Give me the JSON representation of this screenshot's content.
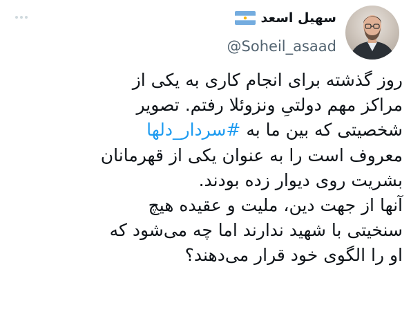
{
  "tweet": {
    "author": {
      "name": "سهیل اسعد",
      "handle": "@Soheil_asaad",
      "flag": "argentina-flag-icon"
    },
    "text_lines": [
      "روز گذشته برای انجام کاری به یکی از",
      "مراکز مهم دولتیِ ونزوئلا رفتم. تصویر",
      "شخصیتی که بین ما به",
      "معروف است را به عنوان یکی از قهرمانان",
      "بشریت روی دیوار زده بودند.",
      "آنها از جهت دین، ملیت و عقیده هیچ",
      "سنخیتی با شهید ندارند اما چه می‌شود که",
      "او را الگوی خود قرار می‌دهند؟"
    ],
    "hashtag": "#سردار_دلها"
  },
  "colors": {
    "text": "#0f1419",
    "secondary": "#536471",
    "link": "#1d9bf0",
    "flag_blue": "#74acdf",
    "flag_sun": "#f6b40e"
  }
}
